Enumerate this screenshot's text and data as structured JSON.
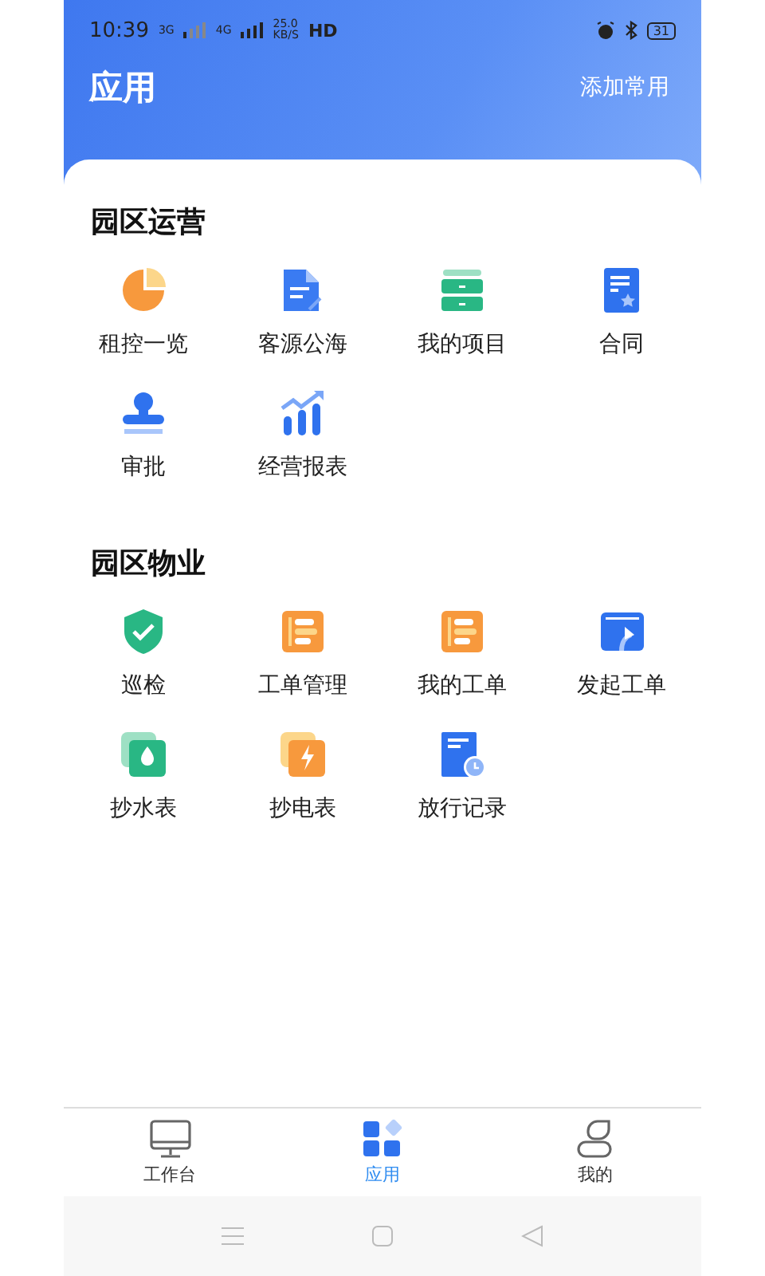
{
  "status_bar": {
    "time": "10:39",
    "network_1": "3G",
    "network_2": "4G",
    "speed": "25.0",
    "speed_unit": "KB/S",
    "hd": "HD",
    "battery": "31"
  },
  "header": {
    "title": "应用",
    "action": "添加常用"
  },
  "sections": [
    {
      "title": "园区运营",
      "apps": [
        {
          "label": "租控一览",
          "kind": "pie"
        },
        {
          "label": "客源公海",
          "kind": "doc"
        },
        {
          "label": "我的项目",
          "kind": "cabinet"
        },
        {
          "label": "合同",
          "kind": "contract"
        },
        {
          "label": "审批",
          "kind": "stamp"
        },
        {
          "label": "经营报表",
          "kind": "chart"
        }
      ]
    },
    {
      "title": "园区物业",
      "apps": [
        {
          "label": "巡检",
          "kind": "shield"
        },
        {
          "label": "工单管理",
          "kind": "list"
        },
        {
          "label": "我的工单",
          "kind": "list"
        },
        {
          "label": "发起工单",
          "kind": "upload"
        },
        {
          "label": "抄水表",
          "kind": "water"
        },
        {
          "label": "抄电表",
          "kind": "power"
        },
        {
          "label": "放行记录",
          "kind": "record"
        }
      ]
    }
  ],
  "tabs": [
    {
      "label": "工作台",
      "kind": "desktop",
      "selected": false
    },
    {
      "label": "应用",
      "kind": "apps",
      "selected": true
    },
    {
      "label": "我的",
      "kind": "user",
      "selected": false
    }
  ]
}
